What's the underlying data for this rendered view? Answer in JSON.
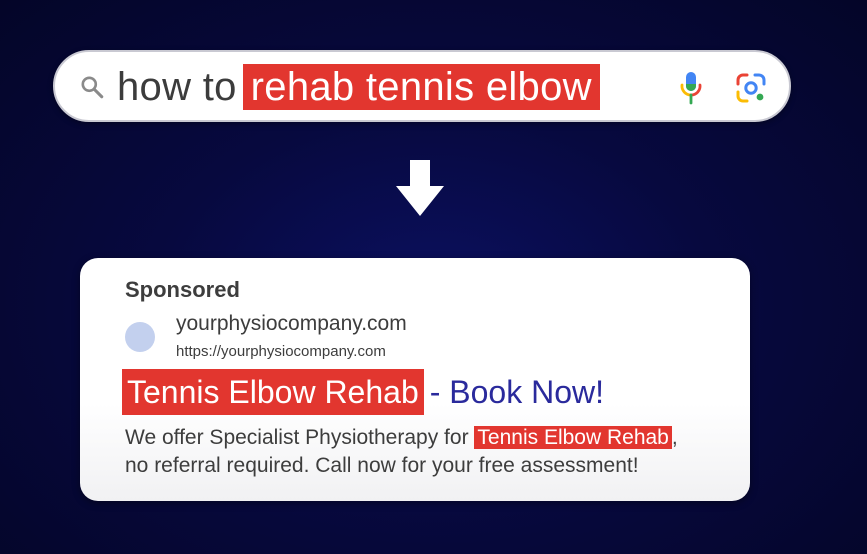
{
  "search": {
    "query_plain": "how to",
    "query_highlight": "rehab tennis elbow",
    "icons": {
      "search": "search-icon",
      "mic": "microphone-icon",
      "lens": "camera-lens-icon"
    }
  },
  "arrow": {
    "icon": "down-arrow-icon"
  },
  "ad": {
    "label": "Sponsored",
    "site_name": "yourphysiocompany.com",
    "site_url": "https://yourphysiocompany.com",
    "headline_highlight": "Tennis Elbow Rehab",
    "headline_rest": "- Book Now!",
    "description": {
      "line1_before": "We offer Specialist Physiotherapy for ",
      "line1_highlight": "Tennis Elbow Rehab",
      "line1_after": ",",
      "line2": "no referral required. Call now for your free assessment!"
    }
  },
  "colors": {
    "highlight": "#e2362f",
    "headline_blue": "#2a2a9c",
    "background": "#07093f",
    "favicon": "#c3d0ee"
  }
}
